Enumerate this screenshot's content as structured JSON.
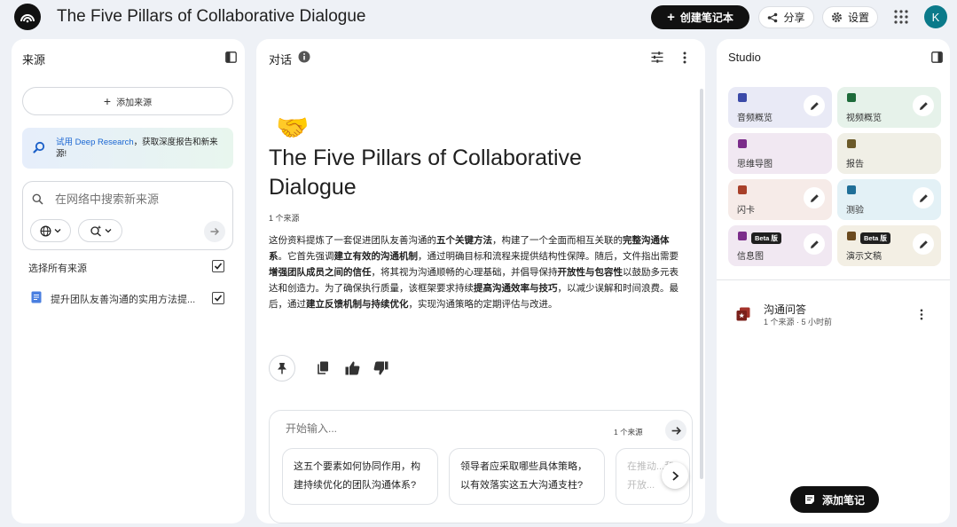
{
  "header": {
    "title": "The Five Pillars of Collaborative Dialogue",
    "create_label": "创建笔记本",
    "share_label": "分享",
    "settings_label": "设置",
    "avatar_letter": "K"
  },
  "sources": {
    "title": "来源",
    "add_label": "添加来源",
    "promo_link": "试用 Deep Research",
    "promo_text": "，获取深度报告和新来源!",
    "search_placeholder": "在网络中搜索新来源",
    "select_all": "选择所有来源",
    "items": [
      {
        "label": "提升团队友善沟通的实用方法提..."
      }
    ]
  },
  "chat": {
    "title": "对话",
    "emoji": "🤝",
    "heading": "The Five Pillars of Collaborative Dialogue",
    "source_count": "1 个来源",
    "summary": [
      {
        "t": "这份资料提炼了一套促进团队友善沟通的",
        "b": false
      },
      {
        "t": "五个关键方法",
        "b": true
      },
      {
        "t": "，构建了一个全面而相互关联的",
        "b": false
      },
      {
        "t": "完整沟通体系",
        "b": true
      },
      {
        "t": "。它首先强调",
        "b": false
      },
      {
        "t": "建立有效的沟通机制",
        "b": true
      },
      {
        "t": "，通过明确目标和流程来提供结构性保障。随后，文件指出需要",
        "b": false
      },
      {
        "t": "增强团队成员之间的信任",
        "b": true
      },
      {
        "t": "，将其视为沟通顺畅的心理基础，并倡导保持",
        "b": false
      },
      {
        "t": "开放性与包容性",
        "b": true
      },
      {
        "t": "以鼓励多元表达和创造力。为了确保执行质量，该框架要求持续",
        "b": false
      },
      {
        "t": "提高沟通效率与技巧",
        "b": true
      },
      {
        "t": "，以减少误解和时间浪费。最后，通过",
        "b": false
      },
      {
        "t": "建立反馈机制与持续优化",
        "b": true
      },
      {
        "t": "，实现沟通策略的定期评估与改进。",
        "b": false
      }
    ],
    "composer_placeholder": "开始输入...",
    "composer_count": "1 个来源",
    "suggestions": [
      "这五个要素如何协同作用，构建持续优化的团队沟通体系?",
      "领导者应采取哪些具体策略，以有效落实这五大沟通支柱?",
      "在推动...和开放..."
    ]
  },
  "studio": {
    "title": "Studio",
    "tiles": [
      {
        "label": "音频概览",
        "bg": "#e9eaf6",
        "icon": "audio-icon",
        "edit": true
      },
      {
        "label": "视频概览",
        "bg": "#e6f2ea",
        "icon": "video-icon",
        "edit": true
      },
      {
        "label": "思维导图",
        "bg": "#f1e8f2",
        "icon": "mindmap-icon",
        "edit": false
      },
      {
        "label": "报告",
        "bg": "#f0efe6",
        "icon": "report-icon",
        "edit": false
      },
      {
        "label": "闪卡",
        "bg": "#f6ebe8",
        "icon": "flashcard-icon",
        "edit": true
      },
      {
        "label": "测验",
        "bg": "#e3f1f6",
        "icon": "quiz-icon",
        "edit": true
      },
      {
        "label": "信息图",
        "bg": "#f1e8f2",
        "icon": "infographic-icon",
        "edit": true,
        "badge": "Beta 版"
      },
      {
        "label": "演示文稿",
        "bg": "#f3efe4",
        "icon": "slides-icon",
        "edit": true,
        "badge": "Beta 版"
      }
    ],
    "note": {
      "title": "沟通问答",
      "sub": "1 个来源 · 5 小时前"
    },
    "add_note_label": "添加笔记"
  }
}
